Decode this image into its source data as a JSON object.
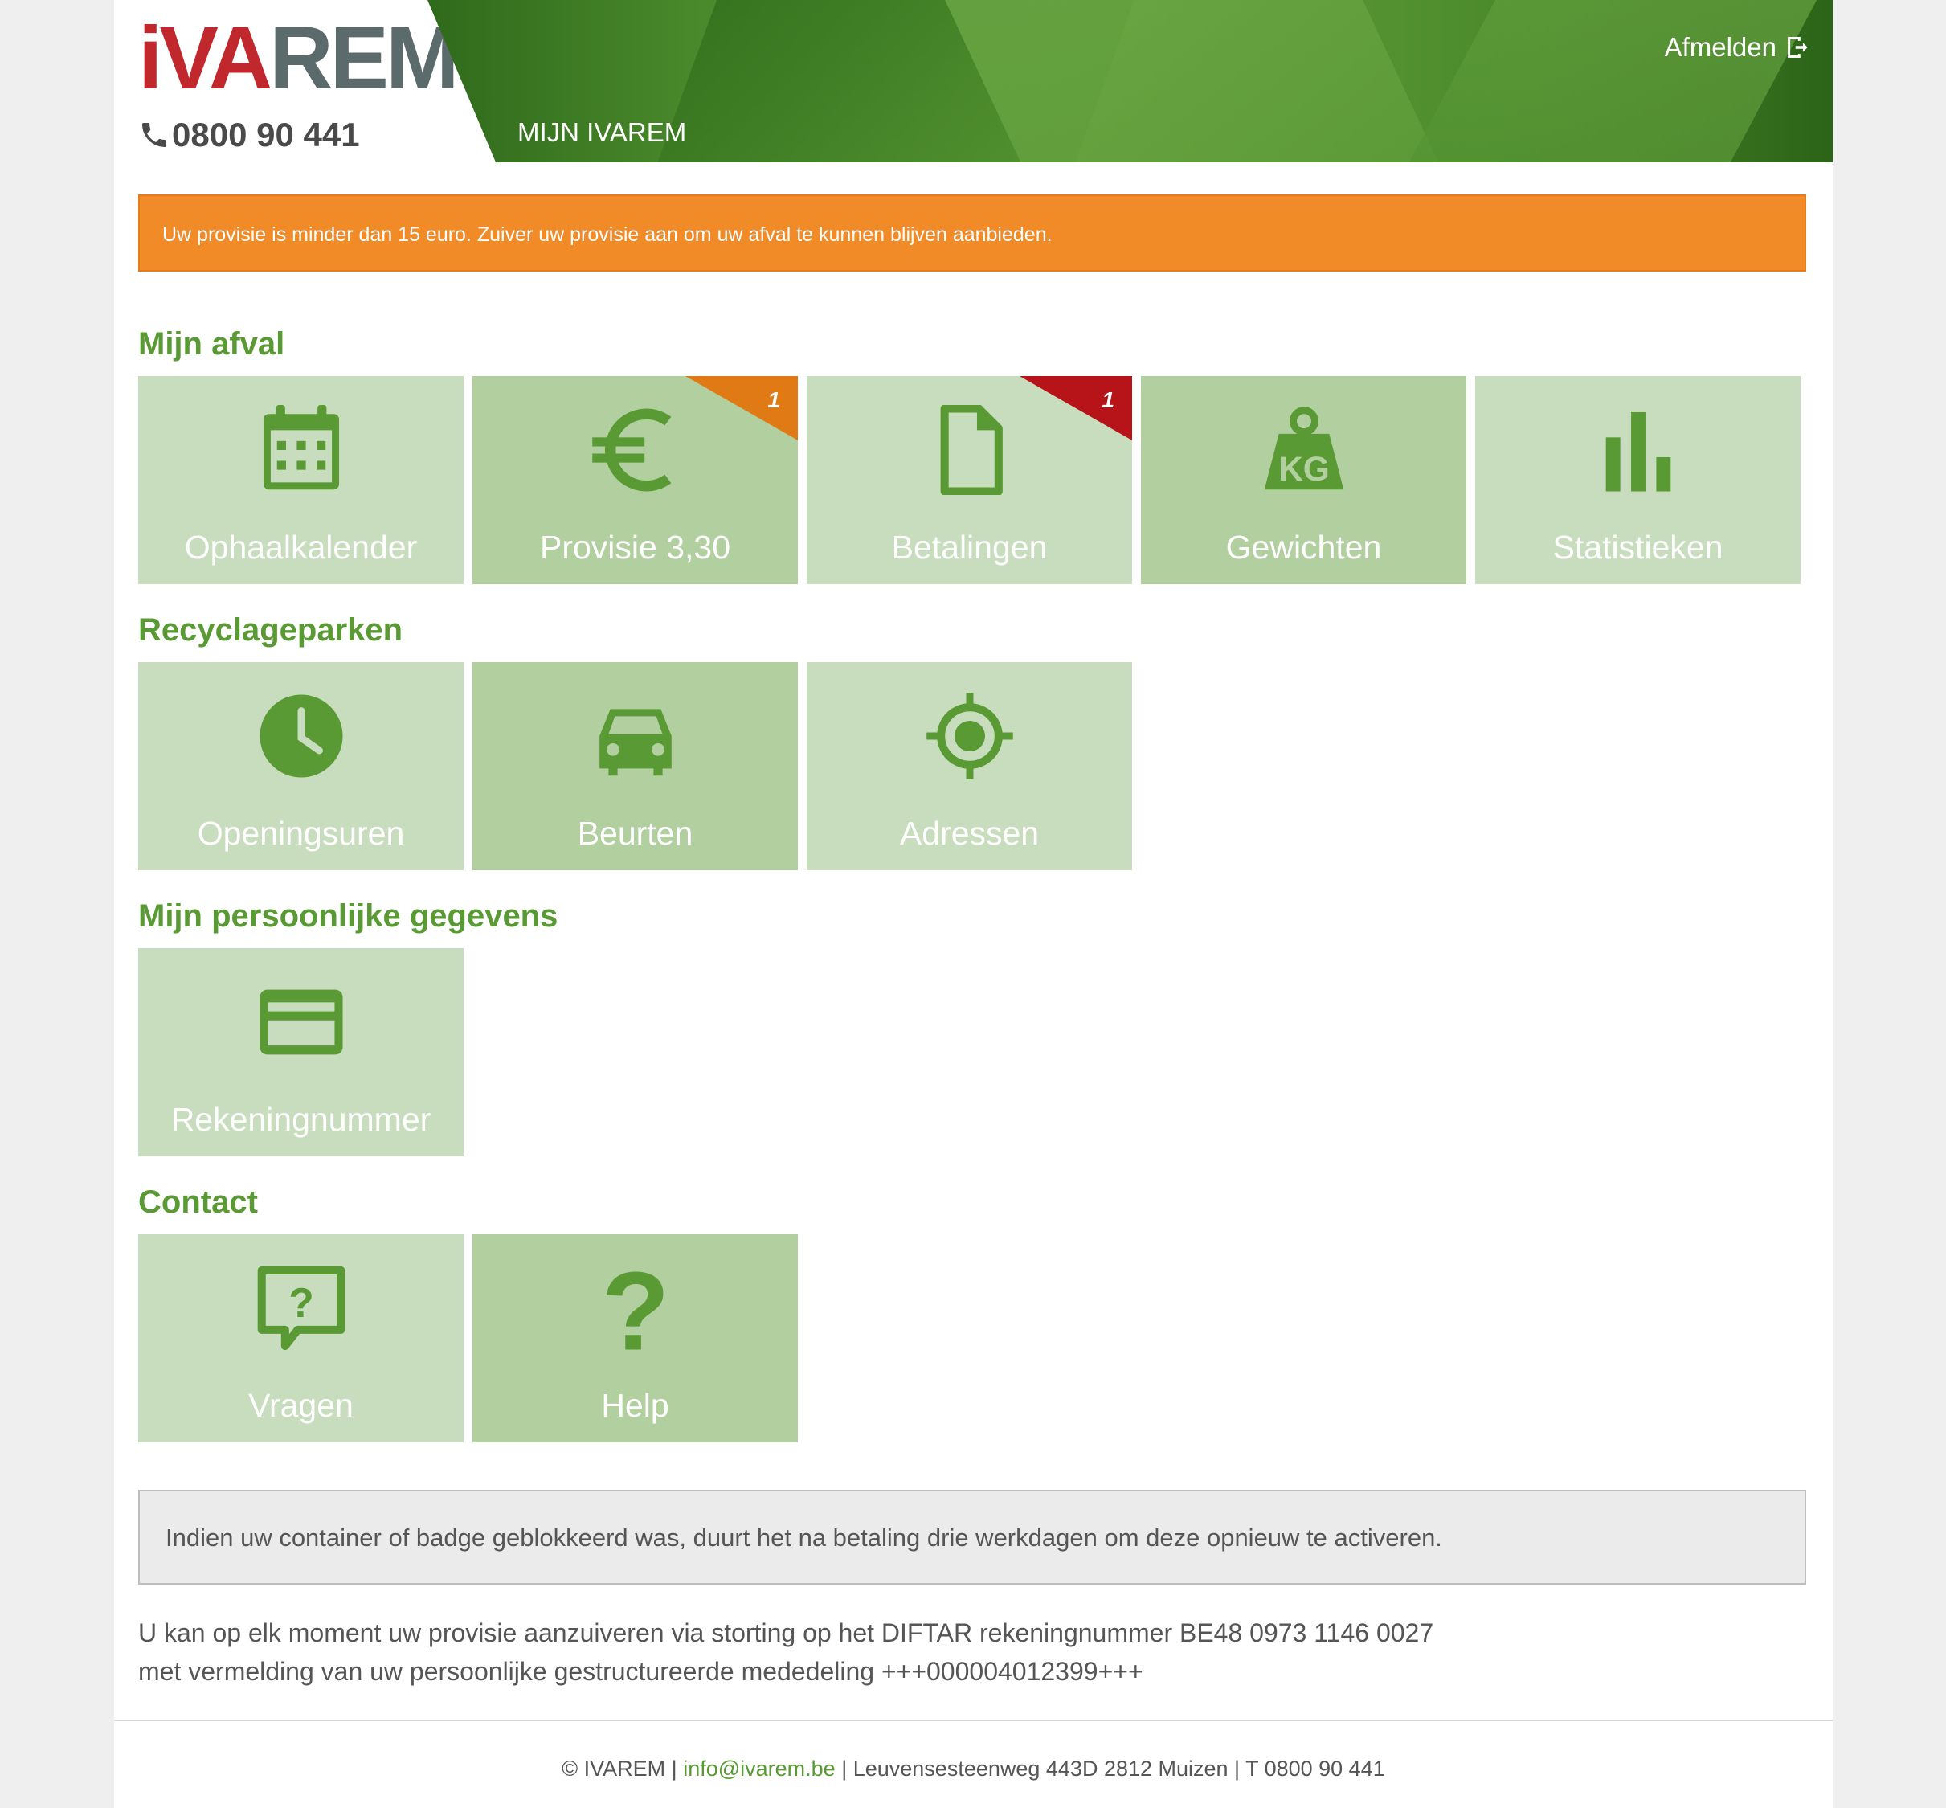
{
  "header": {
    "logo_part1": "iVA",
    "logo_part2": "REM",
    "phone": "0800 90 441",
    "banner_title": "MIJN IVAREM",
    "logout_label": "Afmelden"
  },
  "alert": {
    "text": "Uw provisie is minder dan 15 euro. Zuiver uw provisie aan om uw afval te kunnen blijven aanbieden.",
    "color": "#f08b27"
  },
  "sections": {
    "afval": {
      "title": "Mijn afval",
      "tiles": [
        {
          "label": "Ophaalkalender",
          "icon": "calendar-icon"
        },
        {
          "label": "Provisie 3,30",
          "icon": "euro-icon",
          "badge": "1",
          "badge_color": "#e07a14"
        },
        {
          "label": "Betalingen",
          "icon": "document-icon",
          "badge": "1",
          "badge_color": "#b7141a"
        },
        {
          "label": "Gewichten",
          "icon": "weight-kg-icon"
        },
        {
          "label": "Statistieken",
          "icon": "bar-chart-icon"
        }
      ]
    },
    "recyclage": {
      "title": "Recyclageparken",
      "tiles": [
        {
          "label": "Openingsuren",
          "icon": "clock-icon"
        },
        {
          "label": "Beurten",
          "icon": "car-icon"
        },
        {
          "label": "Adressen",
          "icon": "location-target-icon"
        }
      ]
    },
    "gegevens": {
      "title": "Mijn persoonlijke gegevens",
      "tiles": [
        {
          "label": "Rekeningnummer",
          "icon": "credit-card-icon"
        }
      ]
    },
    "contact": {
      "title": "Contact",
      "tiles": [
        {
          "label": "Vragen",
          "icon": "question-bubble-icon"
        },
        {
          "label": "Help",
          "icon": "question-mark-icon"
        }
      ]
    }
  },
  "info": {
    "box_text": "Indien uw container of badge geblokkeerd was, duurt het na betaling drie werkdagen om deze opnieuw te activeren.",
    "pay_line1": "U kan op elk moment uw provisie aanzuiveren via storting op het DIFTAR rekeningnummer BE48 0973 1146 0027",
    "pay_line2": "met vermelding van uw persoonlijke gestructureerde mededeling +++000004012399+++"
  },
  "footer": {
    "copyright": "© IVAREM | ",
    "email": "info@ivarem.be",
    "address": " | Leuvensesteenweg 443D   2812 Muizen |  T 0800 90 441"
  },
  "colors": {
    "accent_green": "#5a9a34",
    "tile_light": "#c8ddbd",
    "tile_dark": "#b2cf9f"
  }
}
